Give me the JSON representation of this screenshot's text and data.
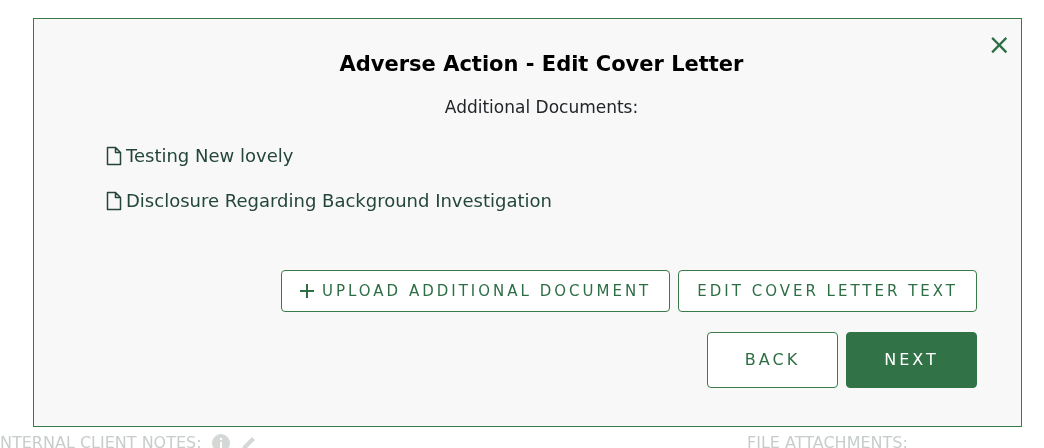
{
  "modal": {
    "title": "Adverse Action - Edit Cover Letter",
    "subtitle": "Additional Documents:",
    "close": "×",
    "documents": [
      "Testing New lovely",
      "Disclosure Regarding Background Investigation"
    ],
    "actions": [
      {
        "label": "UPLOAD ADDITIONAL DOCUMENT",
        "kind": "add"
      },
      {
        "label": "EDIT COVER LETTER TEXT",
        "kind": "plain"
      }
    ],
    "nav": [
      {
        "label": "BACK",
        "primary": false
      },
      {
        "label": "NEXT",
        "primary": true
      }
    ]
  },
  "background": {
    "notes_label": "NTERNAL CLIENT NOTES:",
    "attachments_label": "FILE ATTACHMENTS:"
  }
}
